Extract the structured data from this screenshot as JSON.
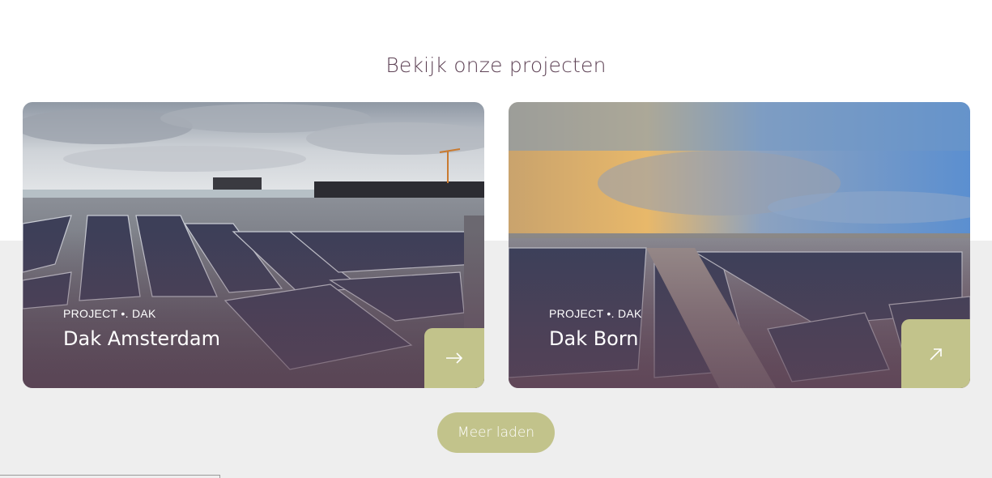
{
  "section": {
    "title": "Bekijk onze projecten"
  },
  "projects": [
    {
      "meta": "PROJECT •. DAK",
      "title": "Dak Amsterdam",
      "arrow_icon": "arrow-right-icon"
    },
    {
      "meta": "PROJECT •. DAK",
      "title": "Dak Born",
      "arrow_icon": "arrow-up-right-icon"
    }
  ],
  "load_more": {
    "label": "Meer laden"
  },
  "colors": {
    "accent": "#c2c38b",
    "title": "#5e4255",
    "band": "#eeeeee"
  }
}
